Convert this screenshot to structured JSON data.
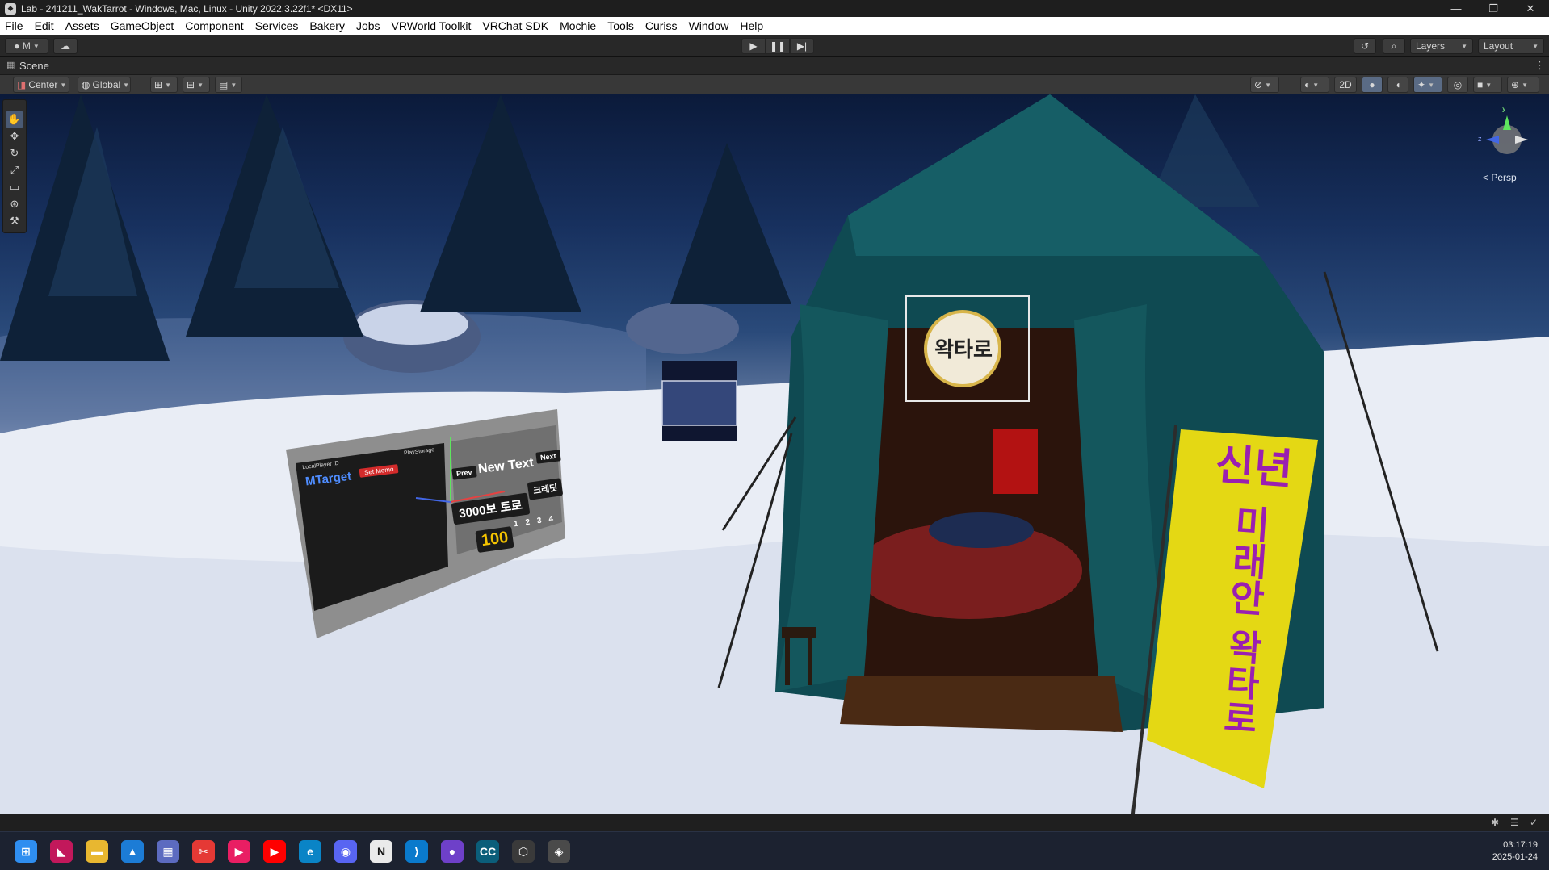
{
  "window": {
    "title": "Lab - 241211_WakTarrot - Windows, Mac, Linux - Unity 2022.3.22f1* <DX11>",
    "minimize": "—",
    "maximize": "❐",
    "close": "✕"
  },
  "menu": [
    "File",
    "Edit",
    "Assets",
    "GameObject",
    "Component",
    "Services",
    "Bakery",
    "Jobs",
    "VRWorld Toolkit",
    "VRChat SDK",
    "Mochie",
    "Tools",
    "Curiss",
    "Window",
    "Help"
  ],
  "toolbar": {
    "account_label": "M",
    "layers_label": "Layers",
    "layout_label": "Layout"
  },
  "scene": {
    "tab_label": "Scene",
    "pivot_label": "Center",
    "space_label": "Global",
    "mode_2d": "2D",
    "persp_label": "< Persp",
    "gizmo_axes": {
      "x": "x",
      "y": "y",
      "z": "z"
    }
  },
  "world": {
    "tent_sign": "왁타로",
    "banner_text": [
      "신년",
      "미래안",
      "왁타로"
    ],
    "panel_header": "LocalPlayer ID",
    "panel_target": "MTarget",
    "panel_red_btn": "Set Memo",
    "panel_top_right": "PlayStorage",
    "panel_prev": "Prev",
    "panel_next": "Next",
    "panel_new_text": "New Text",
    "panel_big_btn": "3000보 토로",
    "panel_side_btn": "크레딧",
    "panel_count": "100",
    "panel_digits": [
      "1",
      "2",
      "3",
      "4"
    ]
  },
  "taskbar": {
    "time": "03:17:19",
    "date": "2025-01-24",
    "apps": [
      {
        "name": "windows-start-icon",
        "glyph": "⊞",
        "color": "#2f8ef0"
      },
      {
        "name": "app-pink-icon",
        "glyph": "◣",
        "color": "#c2185b"
      },
      {
        "name": "file-explorer-icon",
        "glyph": "▬",
        "color": "#e8b730"
      },
      {
        "name": "photos-icon",
        "glyph": "▲",
        "color": "#1c7cd6"
      },
      {
        "name": "store-icon",
        "glyph": "▦",
        "color": "#5c6bc0"
      },
      {
        "name": "snipping-tool-icon",
        "glyph": "✂",
        "color": "#e53935"
      },
      {
        "name": "media-player-icon",
        "glyph": "▶",
        "color": "#e91e63"
      },
      {
        "name": "youtube-icon",
        "glyph": "▶",
        "color": "#ff0000"
      },
      {
        "name": "edge-icon",
        "glyph": "e",
        "color": "#0a84c6"
      },
      {
        "name": "discord-icon",
        "glyph": "◉",
        "color": "#5865f2"
      },
      {
        "name": "notion-icon",
        "glyph": "N",
        "color": "#eaeaea"
      },
      {
        "name": "vscode-icon",
        "glyph": "⟩",
        "color": "#0a7acc"
      },
      {
        "name": "github-icon",
        "glyph": "●",
        "color": "#6e40c9"
      },
      {
        "name": "clip-studio-icon",
        "glyph": "CC",
        "color": "#0b5e7a"
      },
      {
        "name": "unity-hub-icon",
        "glyph": "⬡",
        "color": "#3a3a3a"
      },
      {
        "name": "unity-editor-icon",
        "glyph": "◈",
        "color": "#4a4a4a"
      }
    ]
  }
}
